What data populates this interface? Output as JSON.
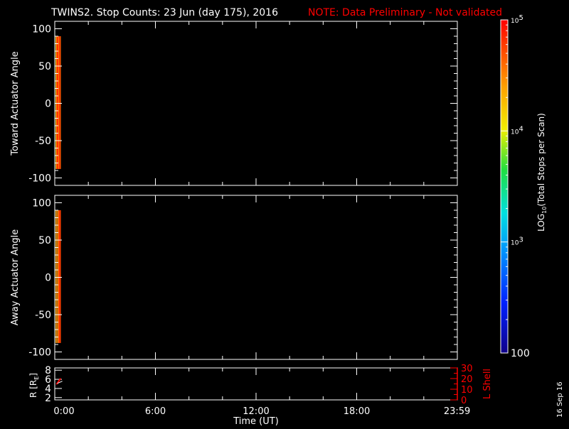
{
  "colors": {
    "axis": "#ffffff",
    "note": "#ff0000",
    "background": "#000000",
    "lshell": "#ff0000",
    "r_trace": "#ff0000"
  },
  "chart_data": [
    {
      "type": "heatmap",
      "title": "TWINS2. Stop Counts: 23 Jun (day 175), 2016",
      "note": "NOTE: Data Preliminary - Not validated",
      "ylabel": "Toward Actuator Angle",
      "ylim": [
        -110,
        110
      ],
      "yticks": [
        100,
        50,
        0,
        -50,
        -100
      ],
      "ytick_labels": [
        "100",
        "50",
        "0",
        "-50",
        "-100"
      ],
      "xlim_hours": [
        0,
        24
      ],
      "data_time_hours": [
        0.05,
        0.35
      ],
      "data_angle_range": [
        -88,
        90
      ],
      "column_log_values": [
        4.2,
        4.55,
        4.75,
        4.9,
        4.7,
        4.45,
        4.8,
        4.95,
        4.6
      ]
    },
    {
      "type": "heatmap",
      "ylabel": "Away Actuator Angle",
      "ylim": [
        -110,
        110
      ],
      "yticks": [
        100,
        50,
        0,
        -50,
        -100
      ],
      "ytick_labels": [
        "100",
        "50",
        "0",
        "-50",
        "-100"
      ],
      "xlim_hours": [
        0,
        24
      ],
      "data_time_hours": [
        0.05,
        0.35
      ],
      "data_angle_range": [
        -88,
        90
      ],
      "column_log_values": [
        4.3,
        4.75,
        3.7,
        4.85,
        4.65,
        4.5,
        4.8,
        4.95,
        4.7
      ]
    },
    {
      "type": "line",
      "ylabel": "R [R",
      "ylabel_sub": "E",
      "ylabel_close": "]",
      "ylim": [
        1.5,
        8.5
      ],
      "yticks": [
        2,
        4,
        6,
        8
      ],
      "ytick_labels": [
        "2",
        "4",
        "6",
        "8"
      ],
      "y2label": "L Shell",
      "y2lim": [
        0,
        30
      ],
      "y2ticks": [
        0,
        10,
        20,
        30
      ],
      "y2tick_labels": [
        "0",
        "10",
        "20",
        "30"
      ],
      "xlabel": "Time (UT)",
      "xticks_hours": [
        0,
        6,
        12,
        18,
        23.983
      ],
      "xtick_labels": [
        "0:00",
        "6:00",
        "12:00",
        "18:00",
        "23:59"
      ],
      "series": [
        {
          "name": "R",
          "x_hours": [
            0.1,
            0.35
          ],
          "y": [
            4.9,
            6.2
          ]
        }
      ]
    }
  ],
  "colorbar": {
    "label_prefix": "LOG",
    "label_sub": "10",
    "label_rest": "(Total Stops per Scan)",
    "log_range": [
      2,
      5
    ],
    "ticks": [
      {
        "log": 5,
        "base": "10",
        "exp": "5"
      },
      {
        "log": 4,
        "base": "10",
        "exp": "4"
      },
      {
        "log": 3,
        "base": "10",
        "exp": "3"
      },
      {
        "log": 2,
        "base": "100",
        "exp": ""
      }
    ]
  },
  "footer_date": "16 Sep 16"
}
